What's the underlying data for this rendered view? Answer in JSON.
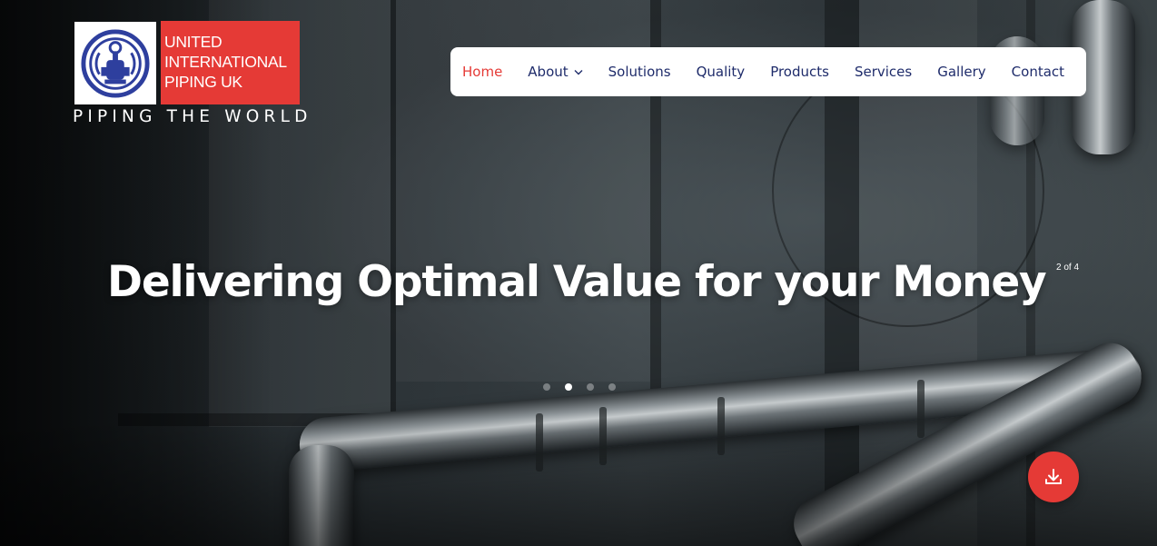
{
  "logo": {
    "name_lines": [
      "UNITED",
      "INTERNATIONAL",
      "PIPING UK"
    ],
    "tagline": "PIPING THE WORLD",
    "emblem_icon": "valve-emblem-icon"
  },
  "nav": {
    "items": [
      {
        "label": "Home",
        "active": true
      },
      {
        "label": "About",
        "has_dropdown": true
      },
      {
        "label": "Solutions"
      },
      {
        "label": "Quality"
      },
      {
        "label": "Products"
      },
      {
        "label": "Services"
      },
      {
        "label": "Gallery"
      },
      {
        "label": "Contact"
      }
    ],
    "dropdown_icon": "chevron-down-icon"
  },
  "hero": {
    "headline": "Delivering Optimal Value for your Money",
    "slide_counter": "2 of 4",
    "slide_count": 4,
    "active_slide": 2
  },
  "fab": {
    "icon": "download-icon"
  },
  "colors": {
    "brand_red": "#e53a36",
    "nav_text": "#1f2c6b",
    "emblem_blue": "#2e3f9e"
  }
}
